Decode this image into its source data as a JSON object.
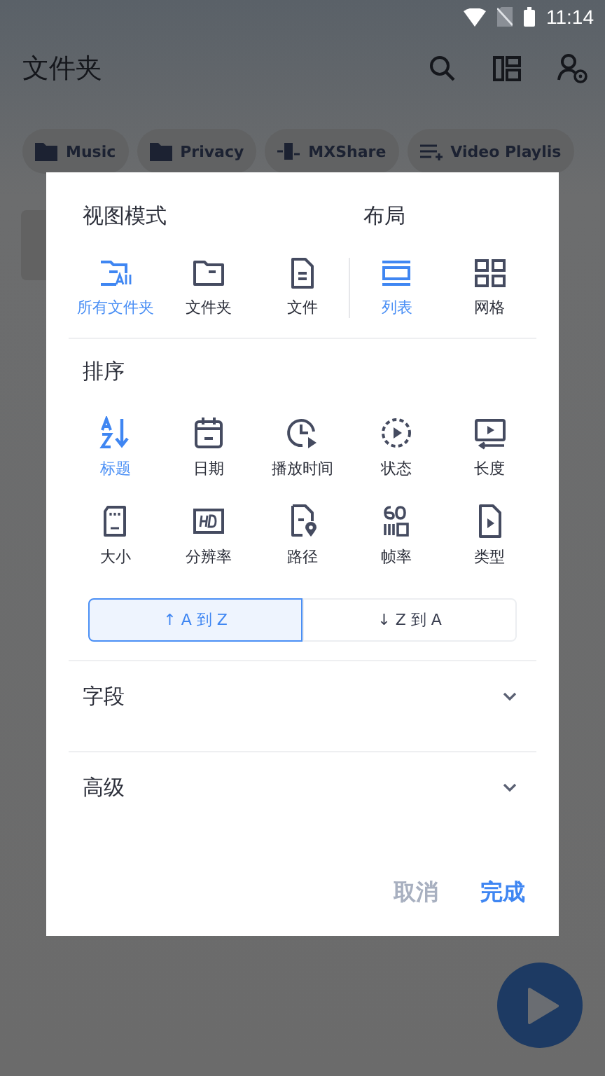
{
  "status_bar": {
    "time": "11:14"
  },
  "app_bar": {
    "title": "文件夹"
  },
  "chips": [
    {
      "label": "Music"
    },
    {
      "label": "Privacy"
    },
    {
      "label": "MXShare"
    },
    {
      "label": "Video Playlis"
    }
  ],
  "dialog": {
    "view_mode": {
      "title": "视图模式",
      "options": [
        {
          "label": "所有文件夹",
          "selected": true
        },
        {
          "label": "文件夹",
          "selected": false
        },
        {
          "label": "文件",
          "selected": false
        }
      ]
    },
    "layout": {
      "title": "布局",
      "options": [
        {
          "label": "列表",
          "selected": true
        },
        {
          "label": "网格",
          "selected": false
        }
      ]
    },
    "sort": {
      "title": "排序",
      "options": [
        {
          "label": "标题",
          "selected": true
        },
        {
          "label": "日期",
          "selected": false
        },
        {
          "label": "播放时间",
          "selected": false
        },
        {
          "label": "状态",
          "selected": false
        },
        {
          "label": "长度",
          "selected": false
        },
        {
          "label": "大小",
          "selected": false
        },
        {
          "label": "分辨率",
          "selected": false
        },
        {
          "label": "路径",
          "selected": false
        },
        {
          "label": "帧率",
          "selected": false
        },
        {
          "label": "类型",
          "selected": false
        }
      ]
    },
    "order": [
      {
        "label": "↑ A 到 Z",
        "selected": true
      },
      {
        "label": "↓ Z 到 A",
        "selected": false
      }
    ],
    "sections": [
      {
        "label": "字段",
        "expanded": false
      },
      {
        "label": "高级",
        "expanded": false
      }
    ],
    "buttons": {
      "cancel": "取消",
      "done": "完成"
    }
  }
}
